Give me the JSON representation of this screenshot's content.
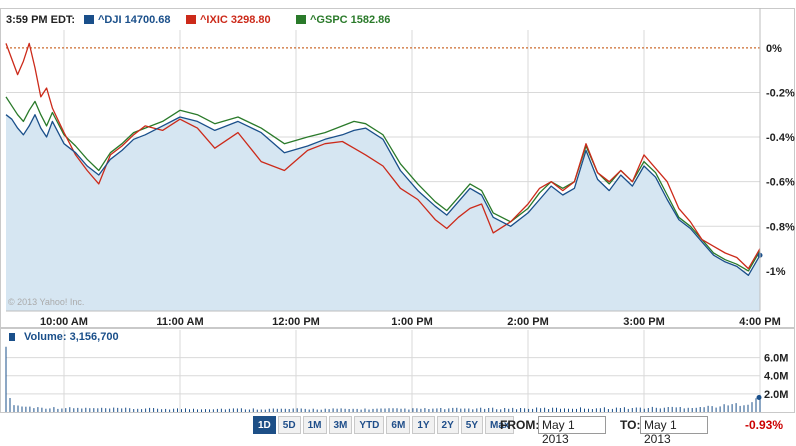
{
  "chart_data": {
    "type": "line",
    "time_label": "3:59 PM EDT:",
    "legend": [
      {
        "symbol": "^DJI",
        "value": "14700.68",
        "color": "#1a4f8a"
      },
      {
        "symbol": "^IXIC",
        "value": "3298.80",
        "color": "#cc2a1a"
      },
      {
        "symbol": "^GSPC",
        "value": "1582.86",
        "color": "#2a7a2a"
      }
    ],
    "x_ticks": [
      "10:00 AM",
      "11:00 AM",
      "12:00 PM",
      "1:00 PM",
      "2:00 PM",
      "3:00 PM",
      "4:00 PM"
    ],
    "y_ticks": [
      "0%",
      "-0.2%",
      "-0.4%",
      "-0.6%",
      "-0.8%",
      "-1%"
    ],
    "ylim": [
      -1.18,
      0.08
    ],
    "x_unit": "hours since 9:30 AM",
    "xlim": [
      0,
      6.5
    ],
    "reference_line": 0,
    "copyright": "© 2013 Yahoo! Inc.",
    "series": [
      {
        "name": "^DJI",
        "color": "#1a4f8a",
        "filled": true,
        "x": [
          0,
          0.05,
          0.1,
          0.15,
          0.2,
          0.25,
          0.3,
          0.35,
          0.4,
          0.5,
          0.6,
          0.7,
          0.8,
          0.9,
          1.0,
          1.1,
          1.2,
          1.35,
          1.5,
          1.65,
          1.8,
          2.0,
          2.2,
          2.4,
          2.6,
          2.75,
          2.9,
          3.0,
          3.1,
          3.25,
          3.4,
          3.55,
          3.7,
          3.8,
          3.9,
          4.0,
          4.1,
          4.2,
          4.35,
          4.5,
          4.6,
          4.7,
          4.8,
          4.9,
          5.0,
          5.1,
          5.2,
          5.3,
          5.4,
          5.5,
          5.6,
          5.7,
          5.8,
          5.9,
          6.0,
          6.1,
          6.2,
          6.3,
          6.4,
          6.5
        ],
        "y": [
          -0.3,
          -0.32,
          -0.36,
          -0.39,
          -0.35,
          -0.3,
          -0.36,
          -0.4,
          -0.33,
          -0.43,
          -0.47,
          -0.53,
          -0.57,
          -0.5,
          -0.46,
          -0.41,
          -0.39,
          -0.35,
          -0.31,
          -0.33,
          -0.37,
          -0.33,
          -0.38,
          -0.47,
          -0.44,
          -0.41,
          -0.39,
          -0.37,
          -0.36,
          -0.41,
          -0.55,
          -0.64,
          -0.71,
          -0.75,
          -0.69,
          -0.63,
          -0.66,
          -0.76,
          -0.8,
          -0.74,
          -0.68,
          -0.62,
          -0.66,
          -0.63,
          -0.46,
          -0.59,
          -0.64,
          -0.57,
          -0.62,
          -0.53,
          -0.58,
          -0.68,
          -0.77,
          -0.81,
          -0.87,
          -0.93,
          -0.96,
          -0.98,
          -1.02,
          -0.93
        ]
      },
      {
        "name": "^IXIC",
        "color": "#cc2a1a",
        "filled": false,
        "x": [
          0,
          0.05,
          0.1,
          0.15,
          0.2,
          0.25,
          0.3,
          0.35,
          0.4,
          0.5,
          0.6,
          0.7,
          0.8,
          0.9,
          1.0,
          1.1,
          1.2,
          1.35,
          1.5,
          1.65,
          1.8,
          2.0,
          2.2,
          2.4,
          2.6,
          2.75,
          2.9,
          3.0,
          3.1,
          3.25,
          3.4,
          3.55,
          3.7,
          3.8,
          3.9,
          4.0,
          4.1,
          4.2,
          4.35,
          4.5,
          4.6,
          4.7,
          4.8,
          4.9,
          5.0,
          5.1,
          5.2,
          5.3,
          5.4,
          5.5,
          5.6,
          5.7,
          5.8,
          5.9,
          6.0,
          6.1,
          6.2,
          6.3,
          6.4,
          6.5
        ],
        "y": [
          0.02,
          -0.05,
          -0.12,
          -0.06,
          0.02,
          -0.09,
          -0.22,
          -0.18,
          -0.27,
          -0.38,
          -0.48,
          -0.55,
          -0.61,
          -0.48,
          -0.44,
          -0.39,
          -0.35,
          -0.37,
          -0.32,
          -0.36,
          -0.45,
          -0.38,
          -0.51,
          -0.55,
          -0.46,
          -0.43,
          -0.42,
          -0.45,
          -0.48,
          -0.53,
          -0.63,
          -0.68,
          -0.77,
          -0.81,
          -0.76,
          -0.72,
          -0.7,
          -0.83,
          -0.78,
          -0.7,
          -0.63,
          -0.6,
          -0.64,
          -0.6,
          -0.43,
          -0.56,
          -0.6,
          -0.55,
          -0.6,
          -0.48,
          -0.54,
          -0.6,
          -0.72,
          -0.78,
          -0.86,
          -0.89,
          -0.92,
          -0.94,
          -0.99,
          -0.9
        ]
      },
      {
        "name": "^GSPC",
        "color": "#2a7a2a",
        "filled": false,
        "x": [
          0,
          0.05,
          0.1,
          0.15,
          0.2,
          0.25,
          0.3,
          0.35,
          0.4,
          0.5,
          0.6,
          0.7,
          0.8,
          0.9,
          1.0,
          1.1,
          1.2,
          1.35,
          1.5,
          1.65,
          1.8,
          2.0,
          2.2,
          2.4,
          2.6,
          2.75,
          2.9,
          3.0,
          3.1,
          3.25,
          3.4,
          3.55,
          3.7,
          3.8,
          3.9,
          4.0,
          4.1,
          4.2,
          4.35,
          4.5,
          4.6,
          4.7,
          4.8,
          4.9,
          5.0,
          5.1,
          5.2,
          5.3,
          5.4,
          5.5,
          5.6,
          5.7,
          5.8,
          5.9,
          6.0,
          6.1,
          6.2,
          6.3,
          6.4,
          6.5
        ],
        "y": [
          -0.22,
          -0.26,
          -0.3,
          -0.33,
          -0.28,
          -0.24,
          -0.3,
          -0.35,
          -0.29,
          -0.39,
          -0.44,
          -0.5,
          -0.55,
          -0.47,
          -0.43,
          -0.38,
          -0.36,
          -0.33,
          -0.28,
          -0.3,
          -0.34,
          -0.31,
          -0.36,
          -0.43,
          -0.4,
          -0.38,
          -0.35,
          -0.33,
          -0.34,
          -0.39,
          -0.52,
          -0.61,
          -0.69,
          -0.73,
          -0.67,
          -0.61,
          -0.64,
          -0.74,
          -0.78,
          -0.72,
          -0.65,
          -0.6,
          -0.63,
          -0.6,
          -0.44,
          -0.56,
          -0.61,
          -0.55,
          -0.6,
          -0.51,
          -0.56,
          -0.66,
          -0.76,
          -0.8,
          -0.86,
          -0.92,
          -0.95,
          -0.97,
          -1.0,
          -0.91
        ]
      }
    ],
    "volume": {
      "label": "Volume: 3,156,700",
      "y_ticks": [
        "6.0M",
        "4.0M",
        "2.0M"
      ],
      "ylim": [
        0,
        7.5
      ],
      "unit": "M",
      "color": "#1a4f8a",
      "x": [
        0,
        0.02,
        0.1,
        0.25,
        0.5,
        0.75,
        1.0,
        1.5,
        2.0,
        2.5,
        3.0,
        3.5,
        4.0,
        4.5,
        5.0,
        5.5,
        6.0,
        6.2,
        6.4,
        6.48
      ],
      "y": [
        7.2,
        1.4,
        0.7,
        0.5,
        0.45,
        0.4,
        0.38,
        0.35,
        0.35,
        0.33,
        0.33,
        0.35,
        0.38,
        0.4,
        0.42,
        0.45,
        0.55,
        0.7,
        1.0,
        1.6
      ]
    }
  },
  "controls": {
    "ranges": [
      "1D",
      "5D",
      "1M",
      "3M",
      "YTD",
      "6M",
      "1Y",
      "2Y",
      "5Y",
      "Max"
    ],
    "active_range": "1D",
    "from_label": "FROM:",
    "from_value": "May 1 2013",
    "to_label": "TO:",
    "to_value": "May 1 2013",
    "change": "-0.93%"
  },
  "colors": {
    "grid": "#d9d9d9",
    "fill": "#d6e6f2",
    "reference": "#cc6b2e"
  }
}
